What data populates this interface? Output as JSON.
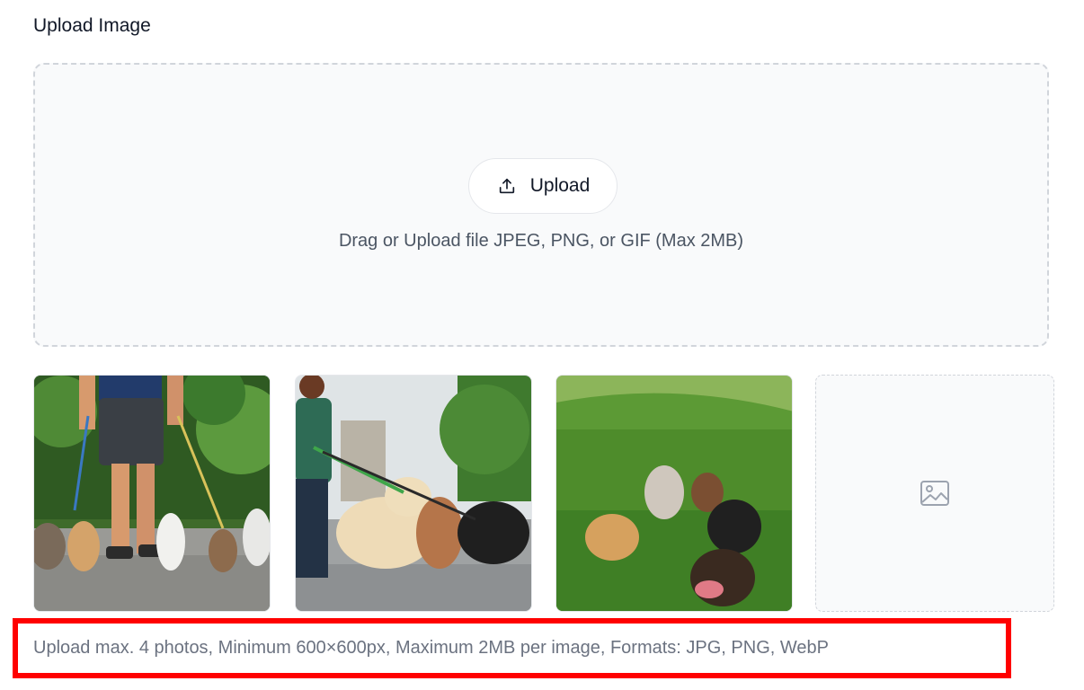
{
  "section_title": "Upload Image",
  "dropzone": {
    "upload_button_label": "Upload",
    "upload_icon": "upload-icon",
    "hint": "Drag or Upload file JPEG, PNG, or GIF (Max 2MB)"
  },
  "thumbnails": [
    {
      "icon": "photo",
      "subject": "dog-walker-legs-with-dogs"
    },
    {
      "icon": "photo",
      "subject": "woman-walking-dogs-street"
    },
    {
      "icon": "photo",
      "subject": "dogs-on-grass-hill"
    },
    {
      "icon": "image-placeholder-icon",
      "empty": true
    }
  ],
  "requirements_text": "Upload max. 4 photos, Minimum 600×600px, Maximum 2MB per image, Formats: JPG, PNG, WebP",
  "colors": {
    "dropzone_bg": "#f9fafb",
    "dashed_border": "#d1d5db",
    "highlight_border": "#ff0000",
    "muted_text": "#6b7280"
  }
}
